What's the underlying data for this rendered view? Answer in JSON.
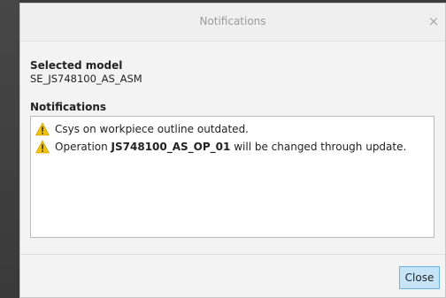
{
  "dialog": {
    "title": "Notifications",
    "close_glyph": "×"
  },
  "selected_model": {
    "heading": "Selected model",
    "value": "SE_JS748100_AS_ASM"
  },
  "notifications": {
    "heading": "Notifications",
    "items": [
      {
        "icon": "warning-icon",
        "prefix": "Csys on workpiece outline outdated.",
        "bold": "",
        "suffix": ""
      },
      {
        "icon": "warning-icon",
        "prefix": "Operation ",
        "bold": "JS748100_AS_OP_01",
        "suffix": " will be changed through update."
      }
    ]
  },
  "footer": {
    "close_label": "Close"
  },
  "colors": {
    "accent_button_bg": "#c6e4f7",
    "accent_button_border": "#6ab3e3",
    "warning_yellow": "#f2c200"
  }
}
